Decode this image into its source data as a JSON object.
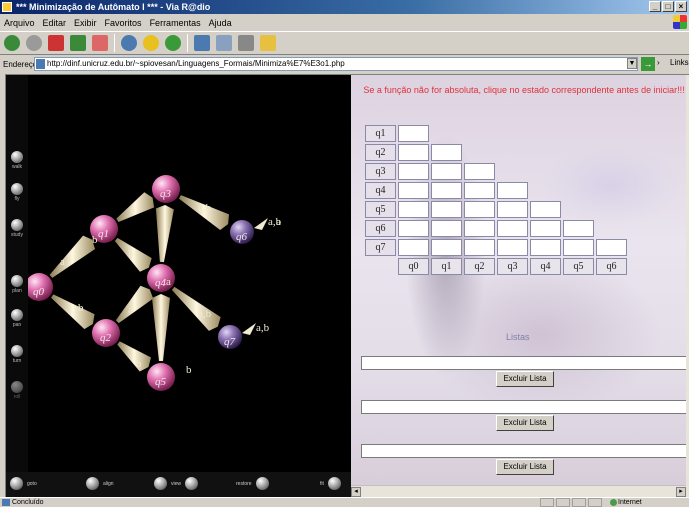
{
  "window": {
    "title": "*** Minimização de Autômato I *** - Via R@dio"
  },
  "menu": [
    "Arquivo",
    "Editar",
    "Exibir",
    "Favoritos",
    "Ferramentas",
    "Ajuda"
  ],
  "address": {
    "label": "Endereço",
    "url": "http://dinf.unicruz.edu.br/~spiovesan/Linguagens_Formais/Minimiza%E7%E3o1.php",
    "links_label": "Links"
  },
  "viewer": {
    "side_nav": [
      "walk",
      "fly",
      "study",
      "plan",
      "pan",
      "turn",
      "roll"
    ],
    "bottom_nav": [
      "goto",
      "align",
      "view",
      "restore",
      "fit"
    ],
    "states": [
      {
        "id": "q0",
        "color": "pink"
      },
      {
        "id": "q1",
        "color": "pink"
      },
      {
        "id": "q2",
        "color": "pink"
      },
      {
        "id": "q3",
        "color": "pink"
      },
      {
        "id": "q4",
        "color": "pink"
      },
      {
        "id": "q5",
        "color": "pink"
      },
      {
        "id": "q6",
        "color": "purple"
      },
      {
        "id": "q7",
        "color": "purple"
      }
    ],
    "edge_labels": [
      "a",
      "b",
      "a",
      "b",
      "a",
      "b",
      "a,b",
      "a",
      "b",
      "a,b",
      "a",
      "b",
      "a,b",
      "a,b"
    ]
  },
  "panel": {
    "message": "Se a função não for absoluta, clique no estado correspondente antes de iniciar!!!",
    "row_labels": [
      "q1",
      "q2",
      "q3",
      "q4",
      "q5",
      "q6",
      "q7"
    ],
    "col_labels": [
      "q0",
      "q1",
      "q2",
      "q3",
      "q4",
      "q5",
      "q6"
    ],
    "listas_title": "Listas",
    "excluir_label": "Excluir Lista"
  },
  "status": {
    "text": "Concluído",
    "zone": "Internet"
  }
}
